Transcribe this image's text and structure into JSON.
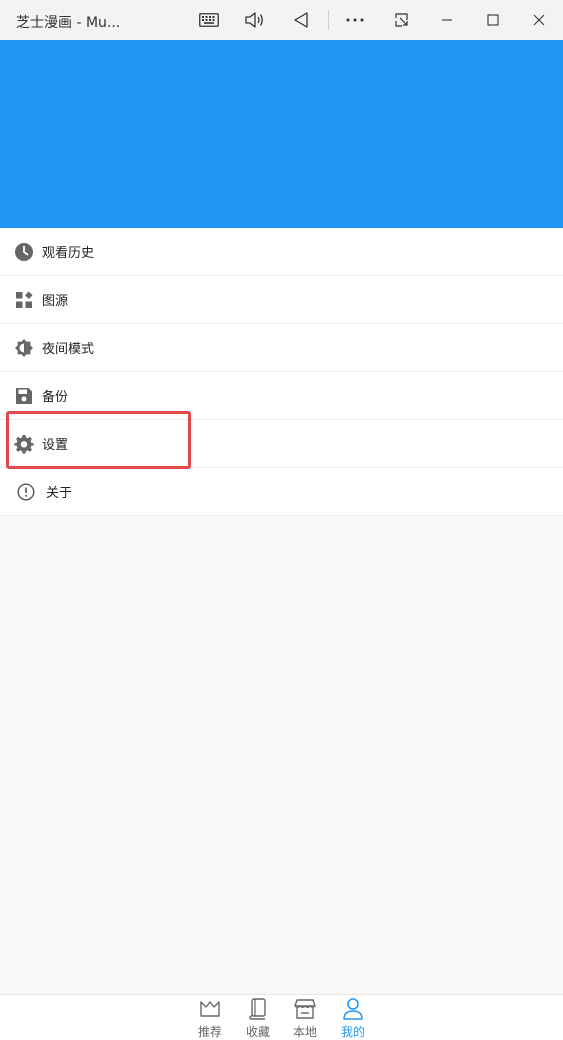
{
  "window": {
    "title": "芝士漫画 - Mu..."
  },
  "titlebar_icons": [
    "keyboard-icon",
    "volume-icon",
    "back-triangle-icon",
    "more-icon",
    "snip-icon",
    "minimize-icon",
    "maximize-icon",
    "close-icon"
  ],
  "colors": {
    "accent": "#2196f3",
    "highlight": "#e2474c",
    "icon_gray": "#666666"
  },
  "menu": {
    "items": [
      {
        "label": "观看历史",
        "icon": "clock-icon"
      },
      {
        "label": "图源",
        "icon": "widgets-icon"
      },
      {
        "label": "夜间模式",
        "icon": "brightness-icon"
      },
      {
        "label": "备份",
        "icon": "save-icon"
      },
      {
        "label": "设置",
        "icon": "gear-icon"
      },
      {
        "label": "关于",
        "icon": "info-icon"
      }
    ]
  },
  "bottom_nav": {
    "items": [
      {
        "label": "推荐",
        "icon": "crown-icon",
        "active": false
      },
      {
        "label": "收藏",
        "icon": "book-icon",
        "active": false
      },
      {
        "label": "本地",
        "icon": "store-icon",
        "active": false
      },
      {
        "label": "我的",
        "icon": "person-icon",
        "active": true
      }
    ]
  }
}
